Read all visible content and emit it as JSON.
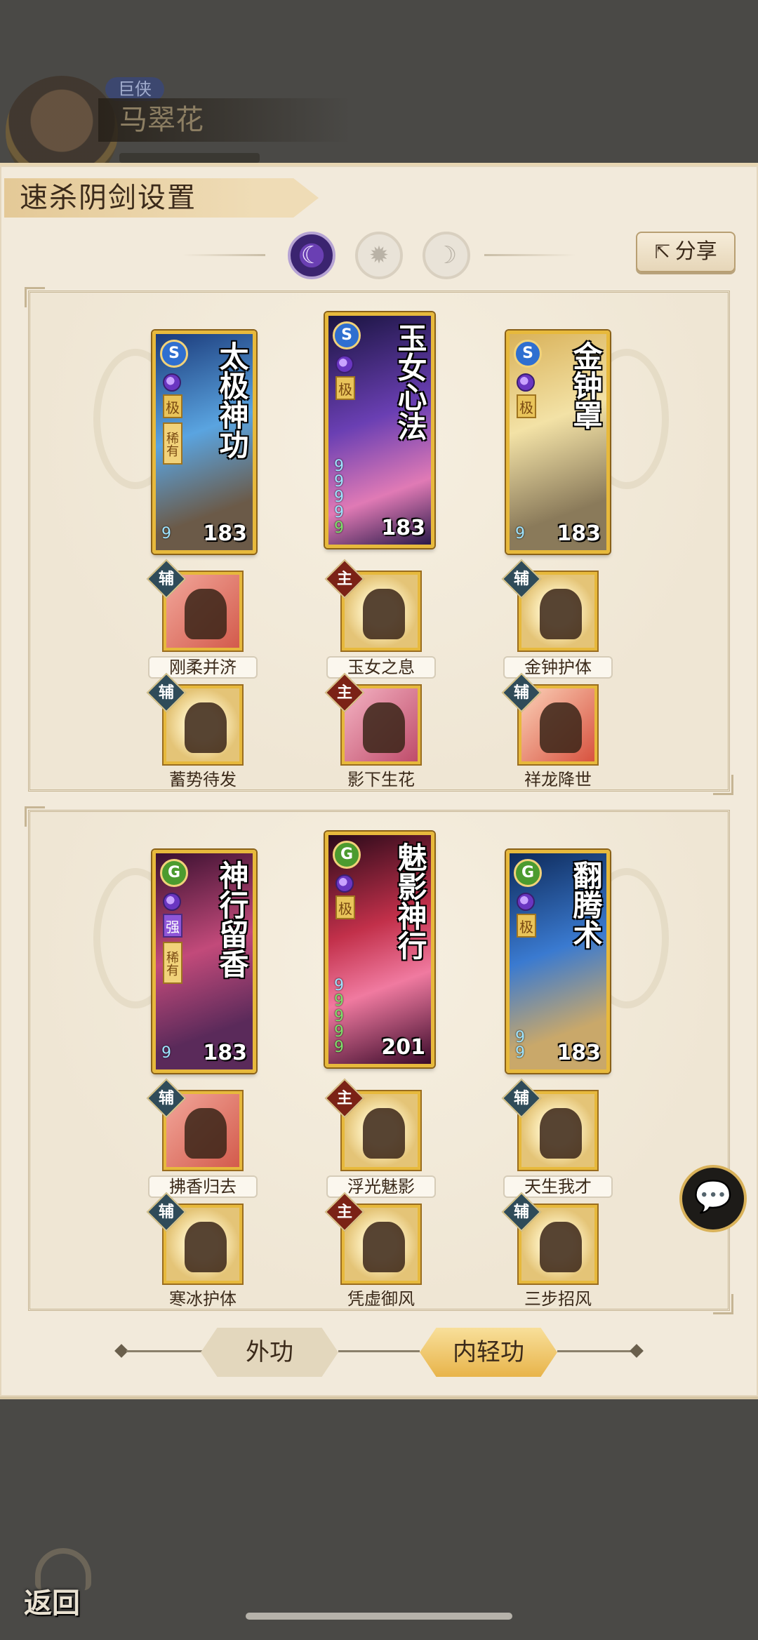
{
  "player": {
    "title_badge": "巨侠",
    "name": "马翠花"
  },
  "panel": {
    "title": "速杀阴剑设置",
    "share_label": "分享",
    "mode_icons": [
      "moon-icon",
      "sun-gear-icon",
      "crescent-icon"
    ],
    "active_mode": 0
  },
  "groups": [
    {
      "skills": [
        {
          "name": "太极神功",
          "type": "S",
          "grade": "极",
          "rarity": "稀有",
          "level": "183",
          "pips": [
            "9"
          ],
          "subs": [
            {
              "role": "辅",
              "label": "刚柔并济",
              "color": "red"
            },
            {
              "role": "辅",
              "label": "蓄势待发",
              "color": "gold"
            }
          ]
        },
        {
          "name": "玉女心法",
          "type": "S",
          "grade": "极",
          "rarity": "",
          "level": "183",
          "pips": [
            "9",
            "9",
            "9",
            "9",
            "9"
          ],
          "subs": [
            {
              "role": "主",
              "label": "玉女之息",
              "color": "gold"
            },
            {
              "role": "主",
              "label": "影下生花",
              "color": "pink"
            }
          ]
        },
        {
          "name": "金钟罩",
          "type": "S",
          "grade": "极",
          "rarity": "",
          "level": "183",
          "pips": [
            "9"
          ],
          "subs": [
            {
              "role": "辅",
              "label": "金钟护体",
              "color": "gold"
            },
            {
              "role": "辅",
              "label": "祥龙降世",
              "color": "redgold"
            }
          ]
        }
      ]
    },
    {
      "skills": [
        {
          "name": "神行留香",
          "type": "G",
          "grade": "强",
          "rarity": "稀有",
          "level": "183",
          "pips": [
            "9"
          ],
          "subs": [
            {
              "role": "辅",
              "label": "拂香归去",
              "color": "red"
            },
            {
              "role": "辅",
              "label": "寒冰护体",
              "color": "gold"
            }
          ]
        },
        {
          "name": "魅影神行",
          "type": "G",
          "grade": "极",
          "rarity": "",
          "level": "201",
          "pips": [
            "9",
            "9",
            "9",
            "9",
            "9"
          ],
          "subs": [
            {
              "role": "主",
              "label": "浮光魅影",
              "color": "gold"
            },
            {
              "role": "主",
              "label": "凭虚御风",
              "color": "gold"
            }
          ]
        },
        {
          "name": "翻腾术",
          "type": "G",
          "grade": "极",
          "rarity": "",
          "level": "183",
          "pips": [
            "9",
            "9"
          ],
          "subs": [
            {
              "role": "辅",
              "label": "天生我才",
              "color": "gold"
            },
            {
              "role": "辅",
              "label": "三步招风",
              "color": "gold"
            }
          ]
        }
      ]
    }
  ],
  "tabs": {
    "outer": "外功",
    "inner": "内轻功",
    "active": "inner"
  },
  "chat_icon": "chat-bubble-icon",
  "back_label": "返回",
  "colors": {
    "panel_bg": "#f2eadb",
    "card_border": "#e7b93c",
    "active_tab": "#e8b44a"
  }
}
